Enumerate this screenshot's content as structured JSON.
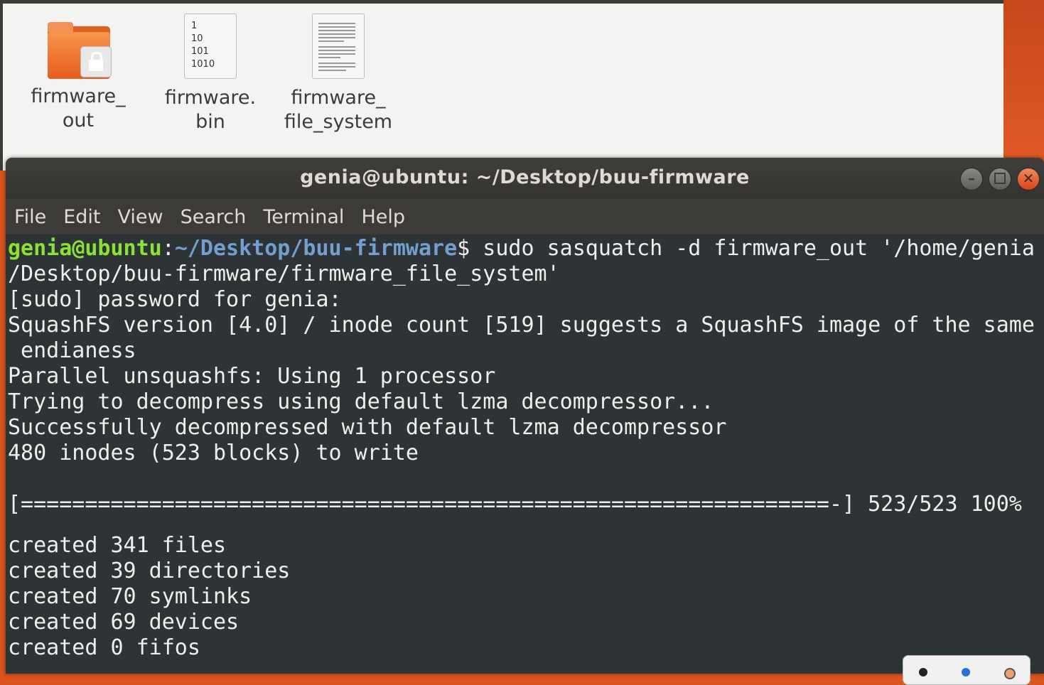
{
  "file_manager": {
    "files": [
      {
        "name": "firmware_\nout",
        "icon": "locked-folder-icon"
      },
      {
        "name": "firmware.\nbin",
        "icon": "binary-file-icon",
        "glyph_lines": [
          "1",
          "10",
          "101",
          "1010"
        ]
      },
      {
        "name": "firmware_\nfile_system",
        "icon": "text-file-icon"
      }
    ]
  },
  "terminal": {
    "title": "genia@ubuntu: ~/Desktop/buu-firmware",
    "menu": [
      "File",
      "Edit",
      "View",
      "Search",
      "Terminal",
      "Help"
    ],
    "prompt_user": "genia@ubuntu",
    "prompt_sep": ":",
    "prompt_path": "~/Desktop/buu-firmware",
    "prompt_end": "$ ",
    "command": "sudo sasquatch -d firmware_out '/home/genia",
    "lines": [
      "/Desktop/buu-firmware/firmware_file_system'",
      "[sudo] password for genia:",
      "SquashFS version [4.0] / inode count [519] suggests a SquashFS image of the same",
      " endianess",
      "Parallel unsquashfs: Using 1 processor",
      "Trying to decompress using default lzma decompressor...",
      "Successfully decompressed with default lzma decompressor",
      "480 inodes (523 blocks) to write",
      "",
      "[===============================================================-] 523/523 100%",
      "",
      "created 341 files",
      "created 39 directories",
      "created 70 symlinks",
      "created 69 devices",
      "created 0 fifos"
    ],
    "colors": {
      "background": "#2e3436",
      "user": "#8ae234",
      "path": "#729fcf",
      "text": "#eeeeec"
    }
  }
}
